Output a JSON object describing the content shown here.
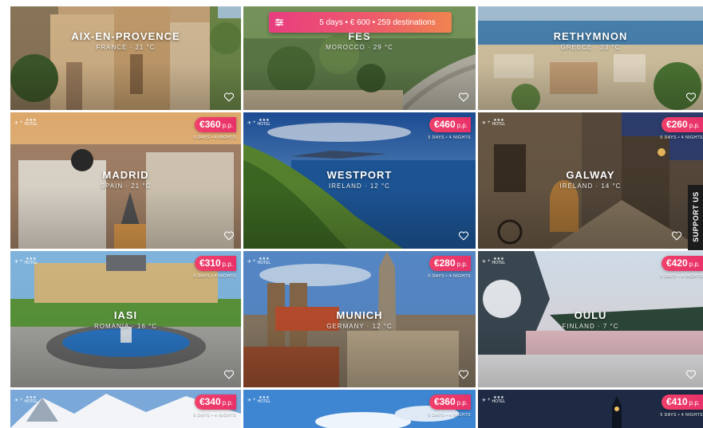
{
  "filter_bar": {
    "label": "5 days • € 600 • 259 destinations"
  },
  "support": {
    "label": "SUPPORT US"
  },
  "package": {
    "flight_plus": "+",
    "stars": "★★★",
    "hotel": "HOTEL"
  },
  "price_suffix": "p.p.",
  "nights_label": "5 DAYS • 4 NIGHTS",
  "tiles": [
    {
      "city": "AIX-EN-PROVENCE",
      "sub": "FRANCE · 21 °C",
      "price": "",
      "bg": "aix"
    },
    {
      "city": "FES",
      "sub": "MOROCCO · 29 °C",
      "price": "",
      "bg": "fes"
    },
    {
      "city": "RETHYMNON",
      "sub": "GREECE · 23 °C",
      "price": "",
      "bg": "reth"
    },
    {
      "city": "MADRID",
      "sub": "SPAIN · 21 °C",
      "price": "€360",
      "bg": "madrid"
    },
    {
      "city": "WESTPORT",
      "sub": "IRELAND · 12 °C",
      "price": "€460",
      "bg": "westport"
    },
    {
      "city": "GALWAY",
      "sub": "IRELAND · 14 °C",
      "price": "€260",
      "bg": "galway"
    },
    {
      "city": "IASI",
      "sub": "ROMANIA · 16 °C",
      "price": "€310",
      "bg": "iasi"
    },
    {
      "city": "MUNICH",
      "sub": "GERMANY · 12 °C",
      "price": "€280",
      "bg": "munich"
    },
    {
      "city": "OULU",
      "sub": "FINLAND · 7 °C",
      "price": "€420",
      "bg": "oulu"
    },
    {
      "city": "",
      "sub": "",
      "price": "€340",
      "bg": "alps"
    },
    {
      "city": "",
      "sub": "",
      "price": "€360",
      "bg": "sky"
    },
    {
      "city": "",
      "sub": "",
      "price": "€410",
      "bg": "night"
    }
  ]
}
